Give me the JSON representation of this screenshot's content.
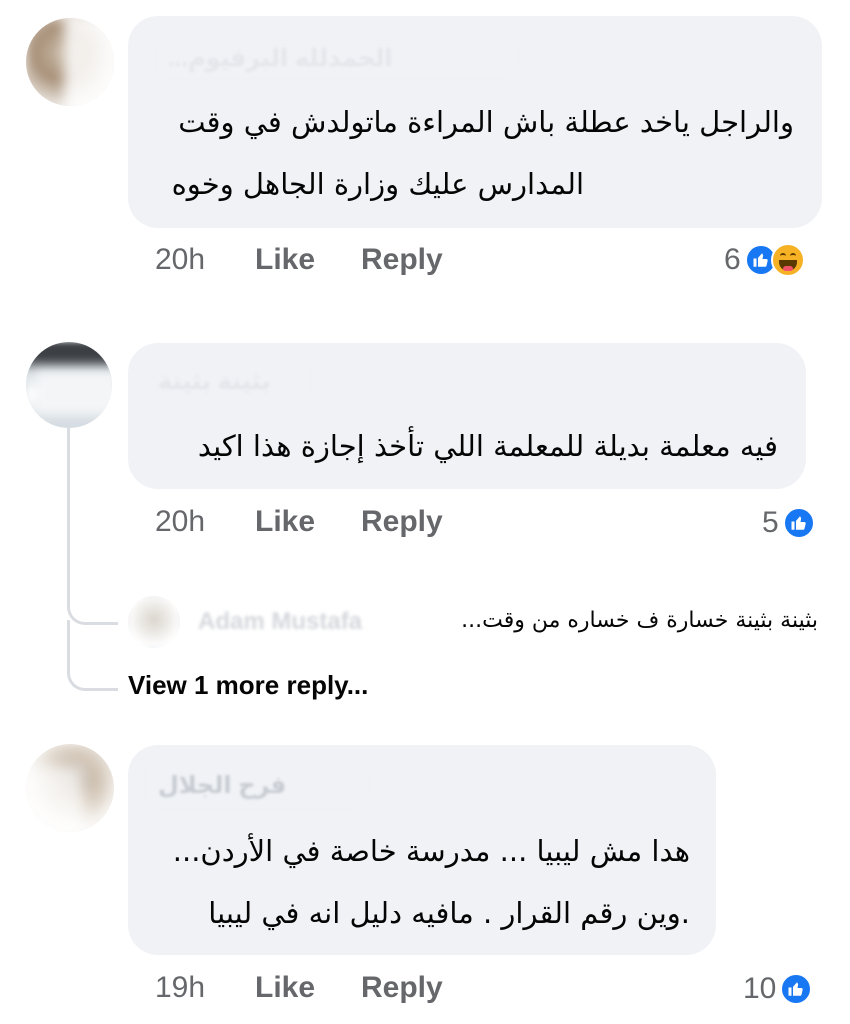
{
  "comments": [
    {
      "author": "...الحمدلله البرفيوم",
      "lines": [
        "والراجل ياخد عطلة باش المراءة ماتولدش في وقت",
        "المدارس عليك وزارة الجاهل وخوه"
      ],
      "time": "20h",
      "like": "Like",
      "reply": "Reply",
      "reaction_count": "6",
      "reactions": [
        "like-icon",
        "haha-icon"
      ]
    },
    {
      "author": "بثينة بثينة",
      "lines": [
        "فيه معلمة بديلة  للمعلمة  اللي تأخذ إجازة هذا اكيد"
      ],
      "time": "20h",
      "like": "Like",
      "reply": "Reply",
      "reaction_count": "5",
      "reactions": [
        "like-icon"
      ],
      "reply_preview": {
        "author": "Adam Mustafa",
        "text": "بثينة بثينة خسارة ف خساره من وقت..."
      },
      "view_more": "View 1 more reply..."
    },
    {
      "author": "فرح الجلال",
      "lines": [
        "هدا مش ليبيا ... مدرسة خاصة في الأردن...",
        ".وين رقم القرار .  مافيه دليل انه في ليبيا"
      ],
      "time": "19h",
      "like": "Like",
      "reply": "Reply",
      "reaction_count": "10",
      "reactions": [
        "like-icon"
      ]
    }
  ],
  "colors": {
    "bubble": "#f0f2f5",
    "like_blue": "#1877f2",
    "meta_gray": "#65676b",
    "text": "#050505"
  }
}
